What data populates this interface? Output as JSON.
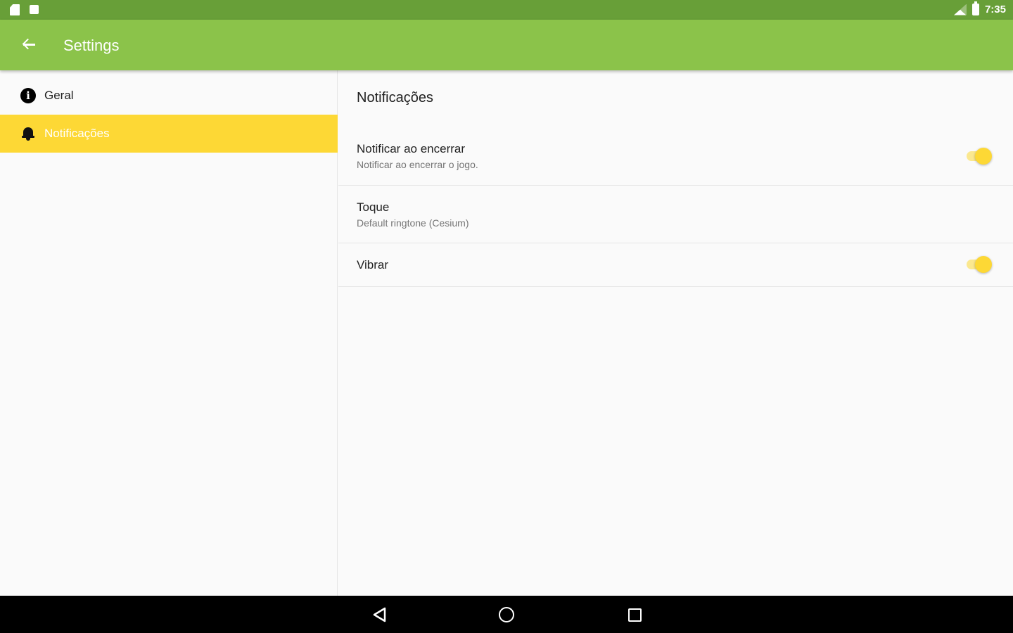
{
  "status_bar": {
    "left_icons": [
      "sd-card-icon",
      "stop-icon"
    ],
    "right_icons": [
      "signal-icon",
      "battery-icon"
    ],
    "time": "7:35"
  },
  "app_bar": {
    "back_icon": "arrow-back-icon",
    "title": "Settings",
    "color": "#8bc34a"
  },
  "sidebar": {
    "items": [
      {
        "label": "Geral",
        "icon": "info-icon",
        "selected": false
      },
      {
        "label": "Notificações",
        "icon": "bell-icon",
        "selected": true
      }
    ],
    "selected_color": "#fdd835"
  },
  "content": {
    "section_title": "Notificações",
    "preferences": [
      {
        "title": "Notificar ao encerrar",
        "summary": "Notificar ao encerrar o jogo.",
        "control": "switch",
        "checked": true
      },
      {
        "title": "Toque",
        "summary": "Default ringtone (Cesium)",
        "control": "none"
      },
      {
        "title": "Vibrar",
        "summary": "",
        "control": "switch",
        "checked": true
      }
    ],
    "switch_color": "#fdd835"
  },
  "nav_bar": {
    "buttons": [
      "nav-back-icon",
      "nav-home-icon",
      "nav-recents-icon"
    ]
  }
}
